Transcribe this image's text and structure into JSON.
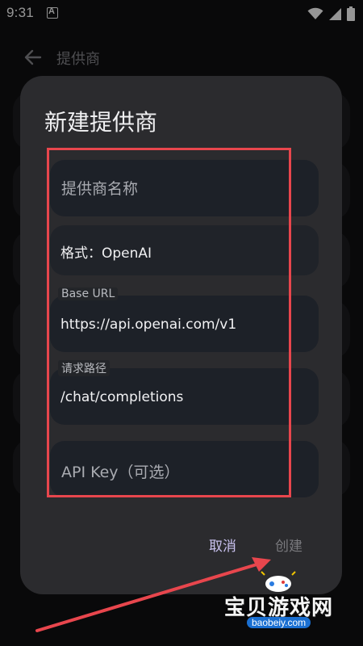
{
  "status_bar": {
    "time": "9:31",
    "notification_icon": "a-badge-icon",
    "icons": [
      "wifi-icon",
      "signal-icon",
      "battery-icon"
    ]
  },
  "app_bar": {
    "title": "提供商",
    "back_icon": "arrow-left-icon"
  },
  "dialog": {
    "title": "新建提供商",
    "fields": {
      "provider_name": {
        "placeholder": "提供商名称"
      },
      "format": {
        "value": "格式：OpenAI"
      },
      "base_url": {
        "label": "Base URL",
        "value": "https://api.openai.com/v1"
      },
      "request_path": {
        "label": "请求路径",
        "value": "/chat/completions"
      },
      "api_key": {
        "placeholder": "API Key（可选）"
      }
    },
    "actions": {
      "cancel": "取消",
      "create": "创建"
    }
  },
  "watermark": {
    "main": "宝贝游戏网",
    "sub": "baobeiy.com"
  },
  "colors": {
    "background": "#0f0f11",
    "dialog": "#2b2b2e",
    "field": "#1d2128",
    "accent": "#c9c2ef",
    "annotation": "#e8464d"
  }
}
